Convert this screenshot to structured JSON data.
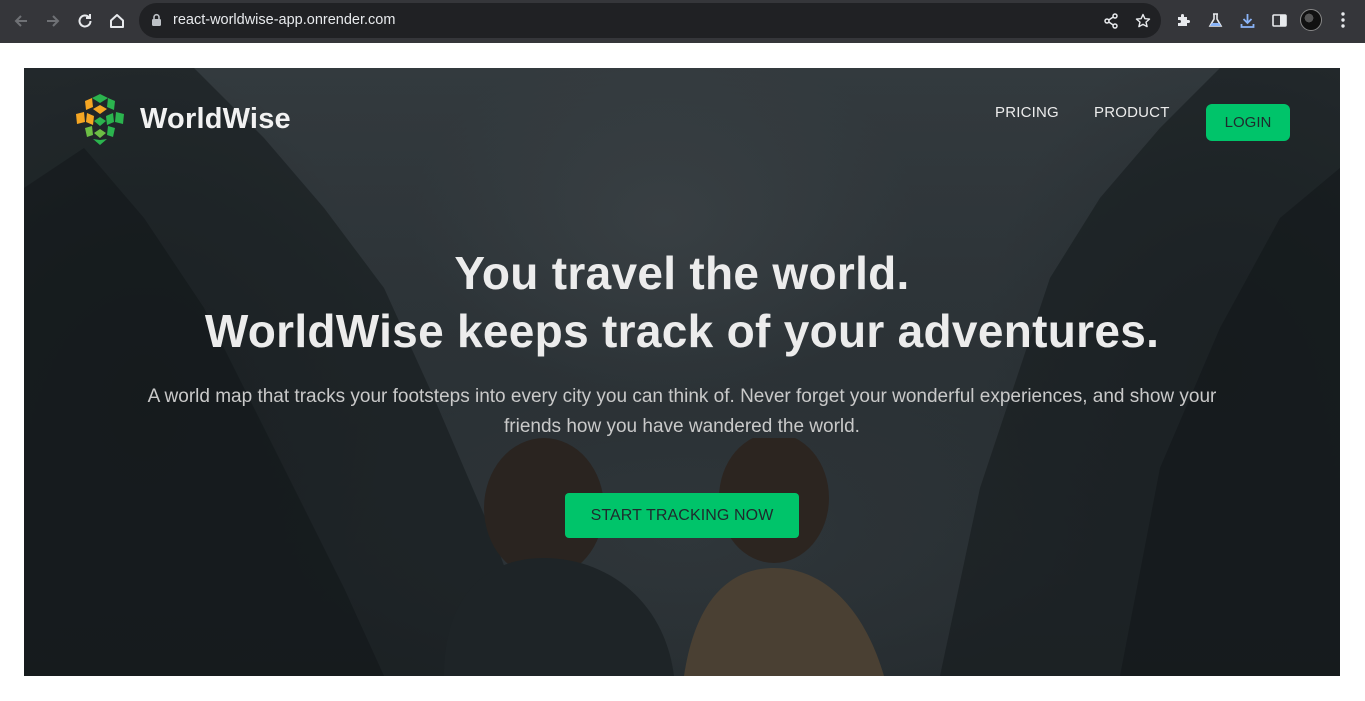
{
  "browser": {
    "url": "react-worldwise-app.onrender.com",
    "icons": {
      "back": "arrow-left-icon",
      "forward": "arrow-right-icon",
      "reload": "reload-icon",
      "home": "home-icon",
      "lock": "lock-icon",
      "share": "share-icon",
      "bookmark": "star-icon",
      "extensions": "puzzle-icon",
      "labs": "flask-icon",
      "download": "download-icon",
      "sidepanel": "side-panel-icon",
      "menu": "kebab-menu-icon"
    }
  },
  "site": {
    "logo_text": "WorldWise",
    "nav": {
      "pricing": "PRICING",
      "product": "PRODUCT",
      "login": "LOGIN"
    },
    "hero": {
      "headline_line1": "You travel the world.",
      "headline_line2": "WorldWise keeps track of your adventures.",
      "subtext": "A world map that tracks your footsteps into every city you can think of. Never forget your wonderful experiences, and show your friends how you have wandered the world.",
      "cta": "START TRACKING NOW"
    }
  },
  "colors": {
    "accent_green": "#00c46a",
    "chrome_bg": "#35363a",
    "omnibox_bg": "#202124",
    "hero_overlay": "#242a2e",
    "text_light": "#ececec"
  }
}
